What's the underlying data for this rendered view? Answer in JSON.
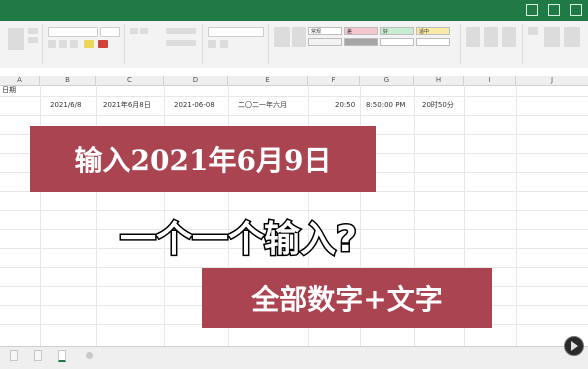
{
  "columns": [
    "A",
    "B",
    "C",
    "D",
    "E",
    "F",
    "G",
    "H",
    "I",
    "J"
  ],
  "row1": {
    "a_label": "日期"
  },
  "row2": [
    "2021/6/8",
    "2021年6月8日",
    "2021-06-08",
    "二〇二一年六月",
    "20:50",
    "8:50:00 PM",
    "20时50分"
  ],
  "banner1": "输入2021年6月9日",
  "banner2": "一个一个输入?",
  "banner3": "全部数字+文字",
  "ribbon_swatches": [
    "常规",
    "差",
    "好",
    "适中"
  ],
  "colors": {
    "excel_green": "#1f7a46",
    "banner_red": "#ab4451"
  }
}
